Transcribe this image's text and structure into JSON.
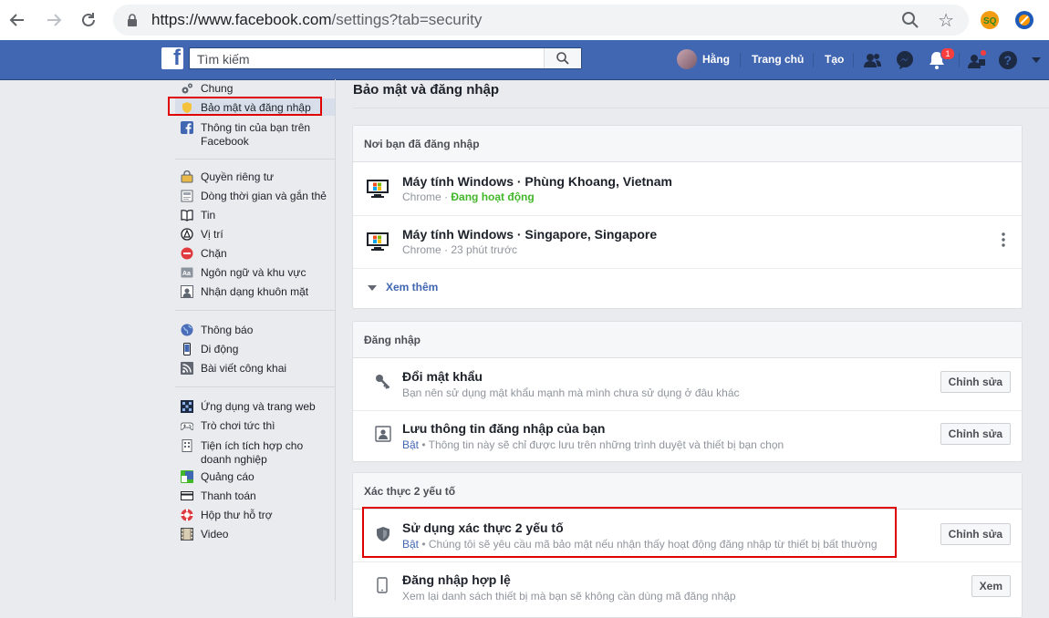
{
  "browser": {
    "url_prefix": "https://www.facebook.com",
    "url_rest": "/settings?tab=security"
  },
  "topbar": {
    "search_placeholder": "Tìm kiếm",
    "user_name": "Hằng",
    "home": "Trang chủ",
    "create": "Tạo",
    "notification_count": "1"
  },
  "sidebar": {
    "groups": [
      [
        {
          "label": "Chung",
          "icon": "gears-icon"
        },
        {
          "label": "Bảo mật và đăng nhập",
          "icon": "shield-badge-icon",
          "active": true
        },
        {
          "label": "Thông tin của bạn trên Facebook",
          "icon": "facebook-icon"
        }
      ],
      [
        {
          "label": "Quyền riêng tư",
          "icon": "lock-icon"
        },
        {
          "label": "Dòng thời gian và gắn thẻ",
          "icon": "timeline-icon"
        },
        {
          "label": "Tin",
          "icon": "book-icon"
        },
        {
          "label": "Vị trí",
          "icon": "location-icon"
        },
        {
          "label": "Chặn",
          "icon": "block-icon"
        },
        {
          "label": "Ngôn ngữ và khu vực",
          "icon": "language-icon"
        },
        {
          "label": "Nhận dạng khuôn mặt",
          "icon": "face-recognition-icon"
        }
      ],
      [
        {
          "label": "Thông báo",
          "icon": "globe-icon"
        },
        {
          "label": "Di động",
          "icon": "mobile-icon"
        },
        {
          "label": "Bài viết công khai",
          "icon": "rss-icon"
        }
      ],
      [
        {
          "label": "Ứng dụng và trang web",
          "icon": "apps-icon"
        },
        {
          "label": "Trò chơi tức thì",
          "icon": "gamepad-icon"
        },
        {
          "label": "Tiện ích tích hợp cho doanh nghiệp",
          "icon": "business-icon"
        },
        {
          "label": "Quảng cáo",
          "icon": "ads-icon"
        },
        {
          "label": "Thanh toán",
          "icon": "payment-icon"
        },
        {
          "label": "Hộp thư hỗ trợ",
          "icon": "lifebuoy-icon"
        },
        {
          "label": "Video",
          "icon": "film-icon"
        }
      ]
    ]
  },
  "main": {
    "title": "Bảo mật và đăng nhập",
    "where_logged_in": {
      "header": "Nơi bạn đã đăng nhập",
      "sessions": [
        {
          "device": "Máy tính Windows · Phùng Khoang, Vietnam",
          "browser": "Chrome",
          "sep": " · ",
          "status": "Đang hoạt động"
        },
        {
          "device": "Máy tính Windows · Singapore, Singapore",
          "browser": "Chrome",
          "sep": " · ",
          "status": "23 phút trước"
        }
      ],
      "see_more": "Xem thêm"
    },
    "login": {
      "header": "Đăng nhập",
      "change_password": {
        "title": "Đổi mật khẩu",
        "desc": "Bạn nên sử dụng mật khẩu mạnh mà mình chưa sử dụng ở đâu khác",
        "button": "Chỉnh sửa"
      },
      "save_login": {
        "title": "Lưu thông tin đăng nhập của bạn",
        "on": "Bật",
        "desc": " • Thông tin này sẽ chỉ được lưu trên những trình duyệt và thiết bị bạn chọn",
        "button": "Chỉnh sửa"
      }
    },
    "two_factor": {
      "header": "Xác thực 2 yếu tố",
      "use_2fa": {
        "title": "Sử dụng xác thực 2 yếu tố",
        "on": "Bật",
        "desc": " • Chúng tôi sẽ yêu cầu mã bảo mật nếu nhận thấy hoạt động đăng nhập từ thiết bị bất thường",
        "button": "Chỉnh sửa"
      },
      "authorized": {
        "title": "Đăng nhập hợp lệ",
        "desc": "Xem lại danh sách thiết bị mà bạn sẽ không cần dùng mã đăng nhập",
        "button": "Xem"
      }
    }
  },
  "colors": {
    "fb_blue": "#4267b2",
    "active_green": "#42b72a",
    "highlight_red": "#e00000"
  }
}
